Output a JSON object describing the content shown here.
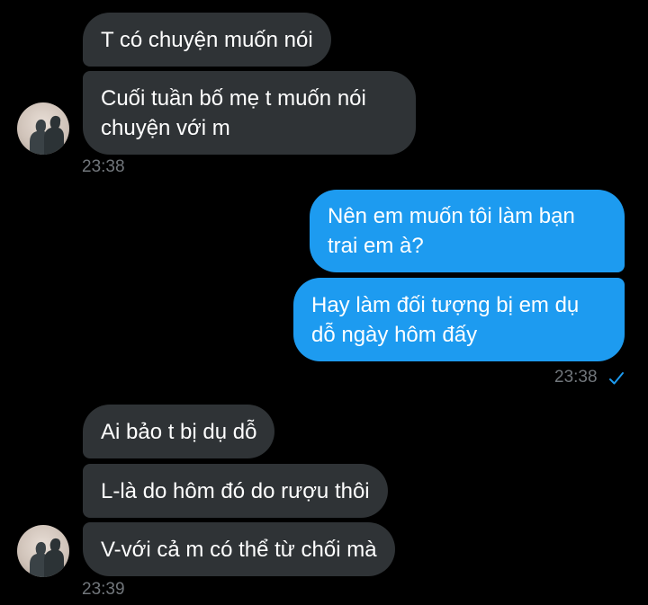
{
  "conversation": {
    "group1": {
      "messages": [
        "T có chuyện muốn nói",
        "Cuối tuần bố mẹ t muốn nói",
        "chuyện với m"
      ],
      "time": "23:38"
    },
    "group2": {
      "messages": [
        "Nên em muốn tôi làm bạn",
        "trai em à?",
        "Hay làm đối tượng bị em dụ",
        "dỗ ngày hôm đấy"
      ],
      "time": "23:38",
      "read_icon": "check-icon"
    },
    "group3": {
      "messages": [
        "Ai bảo t bị dụ dỗ",
        "L-là do hôm đó do rượu thôi",
        "V-với cả m có thể từ chối mà"
      ],
      "time": "23:39"
    }
  },
  "colors": {
    "background": "#000000",
    "incoming_bubble": "#2f3336",
    "outgoing_bubble": "#1d9bf0",
    "timestamp": "#71767b",
    "check": "#1d9bf0"
  }
}
